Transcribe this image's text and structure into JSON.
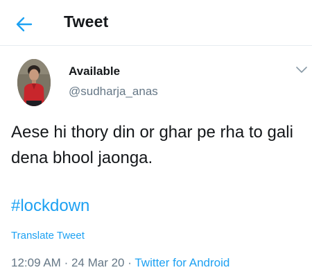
{
  "header": {
    "back_icon": "arrow-left-icon",
    "title": "Tweet"
  },
  "tweet": {
    "author": {
      "display_name": "Available",
      "handle": "@sudharja_anas"
    },
    "more_icon": "chevron-down-icon",
    "text": "Aese hi thory din or ghar pe rha to gali dena bhool jaonga.",
    "hashtag": "#lockdown",
    "translate_label": "Translate Tweet",
    "time": "12:09 AM",
    "separator": "·",
    "date": "24 Mar 20",
    "source": "Twitter for Android"
  },
  "colors": {
    "accent": "#1da1f2",
    "text": "#14171a",
    "secondary": "#657786"
  }
}
